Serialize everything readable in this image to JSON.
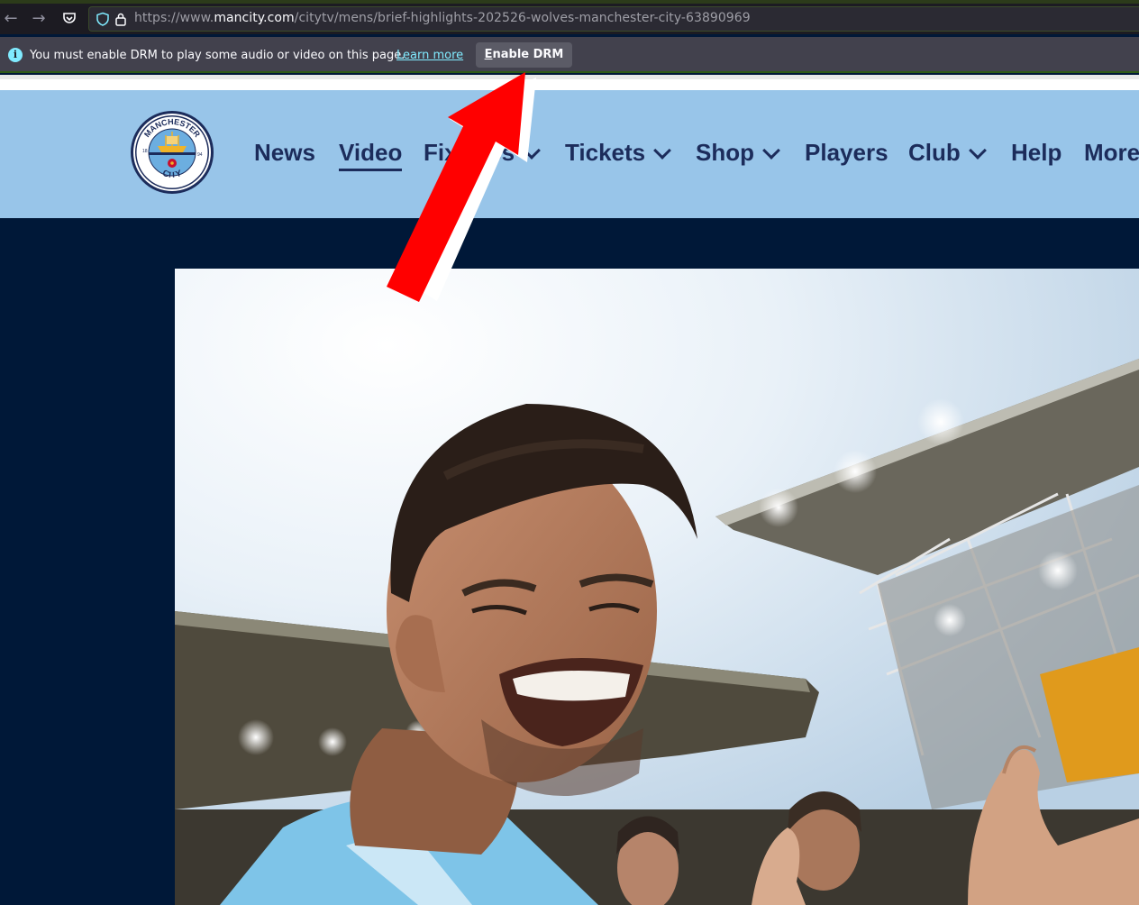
{
  "browser": {
    "url_prefix": "https://www.",
    "url_host": "mancity.com",
    "url_path": "/citytv/mens/brief-highlights-202526-wolves-manchester-city-63890969"
  },
  "drm_notification": {
    "message": "You must enable DRM to play some audio or video on this page.",
    "learn_more": "Learn more",
    "button_first": "E",
    "button_rest": "nable DRM"
  },
  "crest": {
    "top_text": "MANCHESTER",
    "bottom_text": "CITY",
    "year_left": "18",
    "year_right": "94"
  },
  "nav": {
    "items": [
      {
        "label": "News",
        "has_menu": false,
        "active": false
      },
      {
        "label": "Video",
        "has_menu": false,
        "active": true
      },
      {
        "label": "Fixtures",
        "has_menu": true,
        "active": false
      },
      {
        "label": "Tickets",
        "has_menu": true,
        "active": false
      },
      {
        "label": "Shop",
        "has_menu": true,
        "active": false
      },
      {
        "label": "Players",
        "has_menu": false,
        "active": false
      },
      {
        "label": "Club",
        "has_menu": true,
        "active": false
      },
      {
        "label": "Help",
        "has_menu": false,
        "active": false
      },
      {
        "label": "More",
        "has_menu": false,
        "active": false
      }
    ]
  },
  "colors": {
    "header_bg": "#98c5e9",
    "navy": "#1c2c5b",
    "page_bg": "#001838",
    "annotation_arrow": "#ff0000"
  }
}
